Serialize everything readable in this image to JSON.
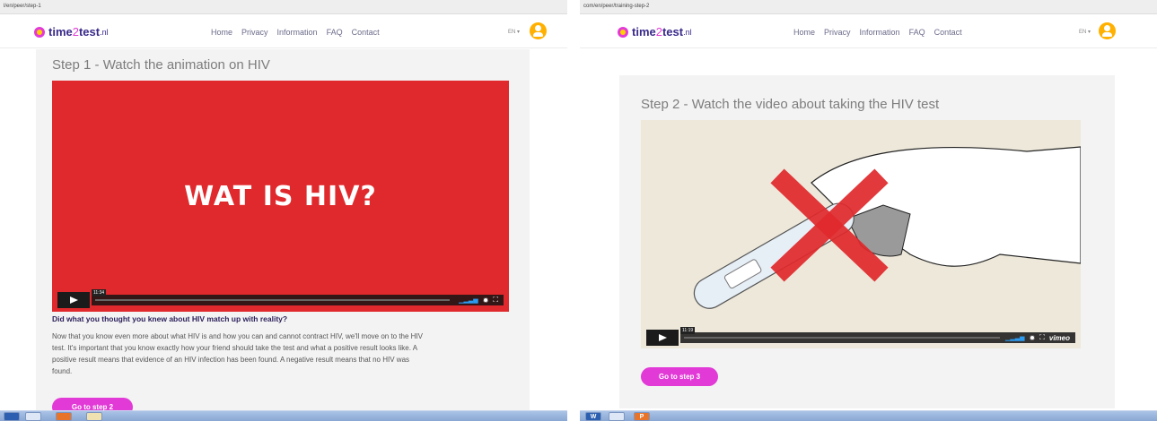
{
  "left": {
    "url": "l/en/peer/step-1",
    "logo": {
      "part1": "time",
      "part2": "2",
      "part3": "test",
      "tld": ".nl"
    },
    "nav": [
      "Home",
      "Privacy",
      "Information",
      "FAQ",
      "Contact"
    ],
    "lang": "EN ▾",
    "step_title": "Step 1 - Watch the animation on HIV",
    "video": {
      "overlay_text": "WAT IS HIV?",
      "time": "11:34",
      "icons": [
        "volume-icon",
        "gear-icon",
        "fullscreen-icon"
      ]
    },
    "question": "Did what you thought you knew about HIV match up with reality?",
    "body_lines": [
      "Now that you know even more about what HIV is and how you can and cannot contract HIV, we'll move on to the HIV",
      "test. It's important that you know exactly how your friend should take the test and what a positive result looks like. A",
      "positive result means that evidence of an HIV infection has been found. A negative result means that no HIV was",
      "found."
    ],
    "button": "Go to step 2",
    "taskbar_icons": [
      "grid-icon",
      "window-icon",
      "powerpoint-icon",
      "tool-icon"
    ]
  },
  "right": {
    "url": "com/en/peer/training-step-2",
    "logo": {
      "part1": "time",
      "part2": "2",
      "part3": "test",
      "tld": ".nl"
    },
    "nav": [
      "Home",
      "Privacy",
      "Information",
      "FAQ",
      "Contact"
    ],
    "lang": "EN ▾",
    "step_title": "Step 2 - Watch the video about taking the HIV test",
    "video": {
      "time": "11:19",
      "brand": "vimeo",
      "icons": [
        "volume-icon",
        "gear-icon",
        "fullscreen-icon"
      ]
    },
    "button": "Go to step 3",
    "taskbar_icons": [
      "word-icon",
      "window-icon",
      "powerpoint-icon"
    ]
  },
  "colors": {
    "brand_pink": "#e23ad6",
    "brand_purple": "#3a2a8a",
    "video_red": "#e0292c",
    "video_beige": "#ede8da",
    "avatar_orange": "#ffb000"
  }
}
